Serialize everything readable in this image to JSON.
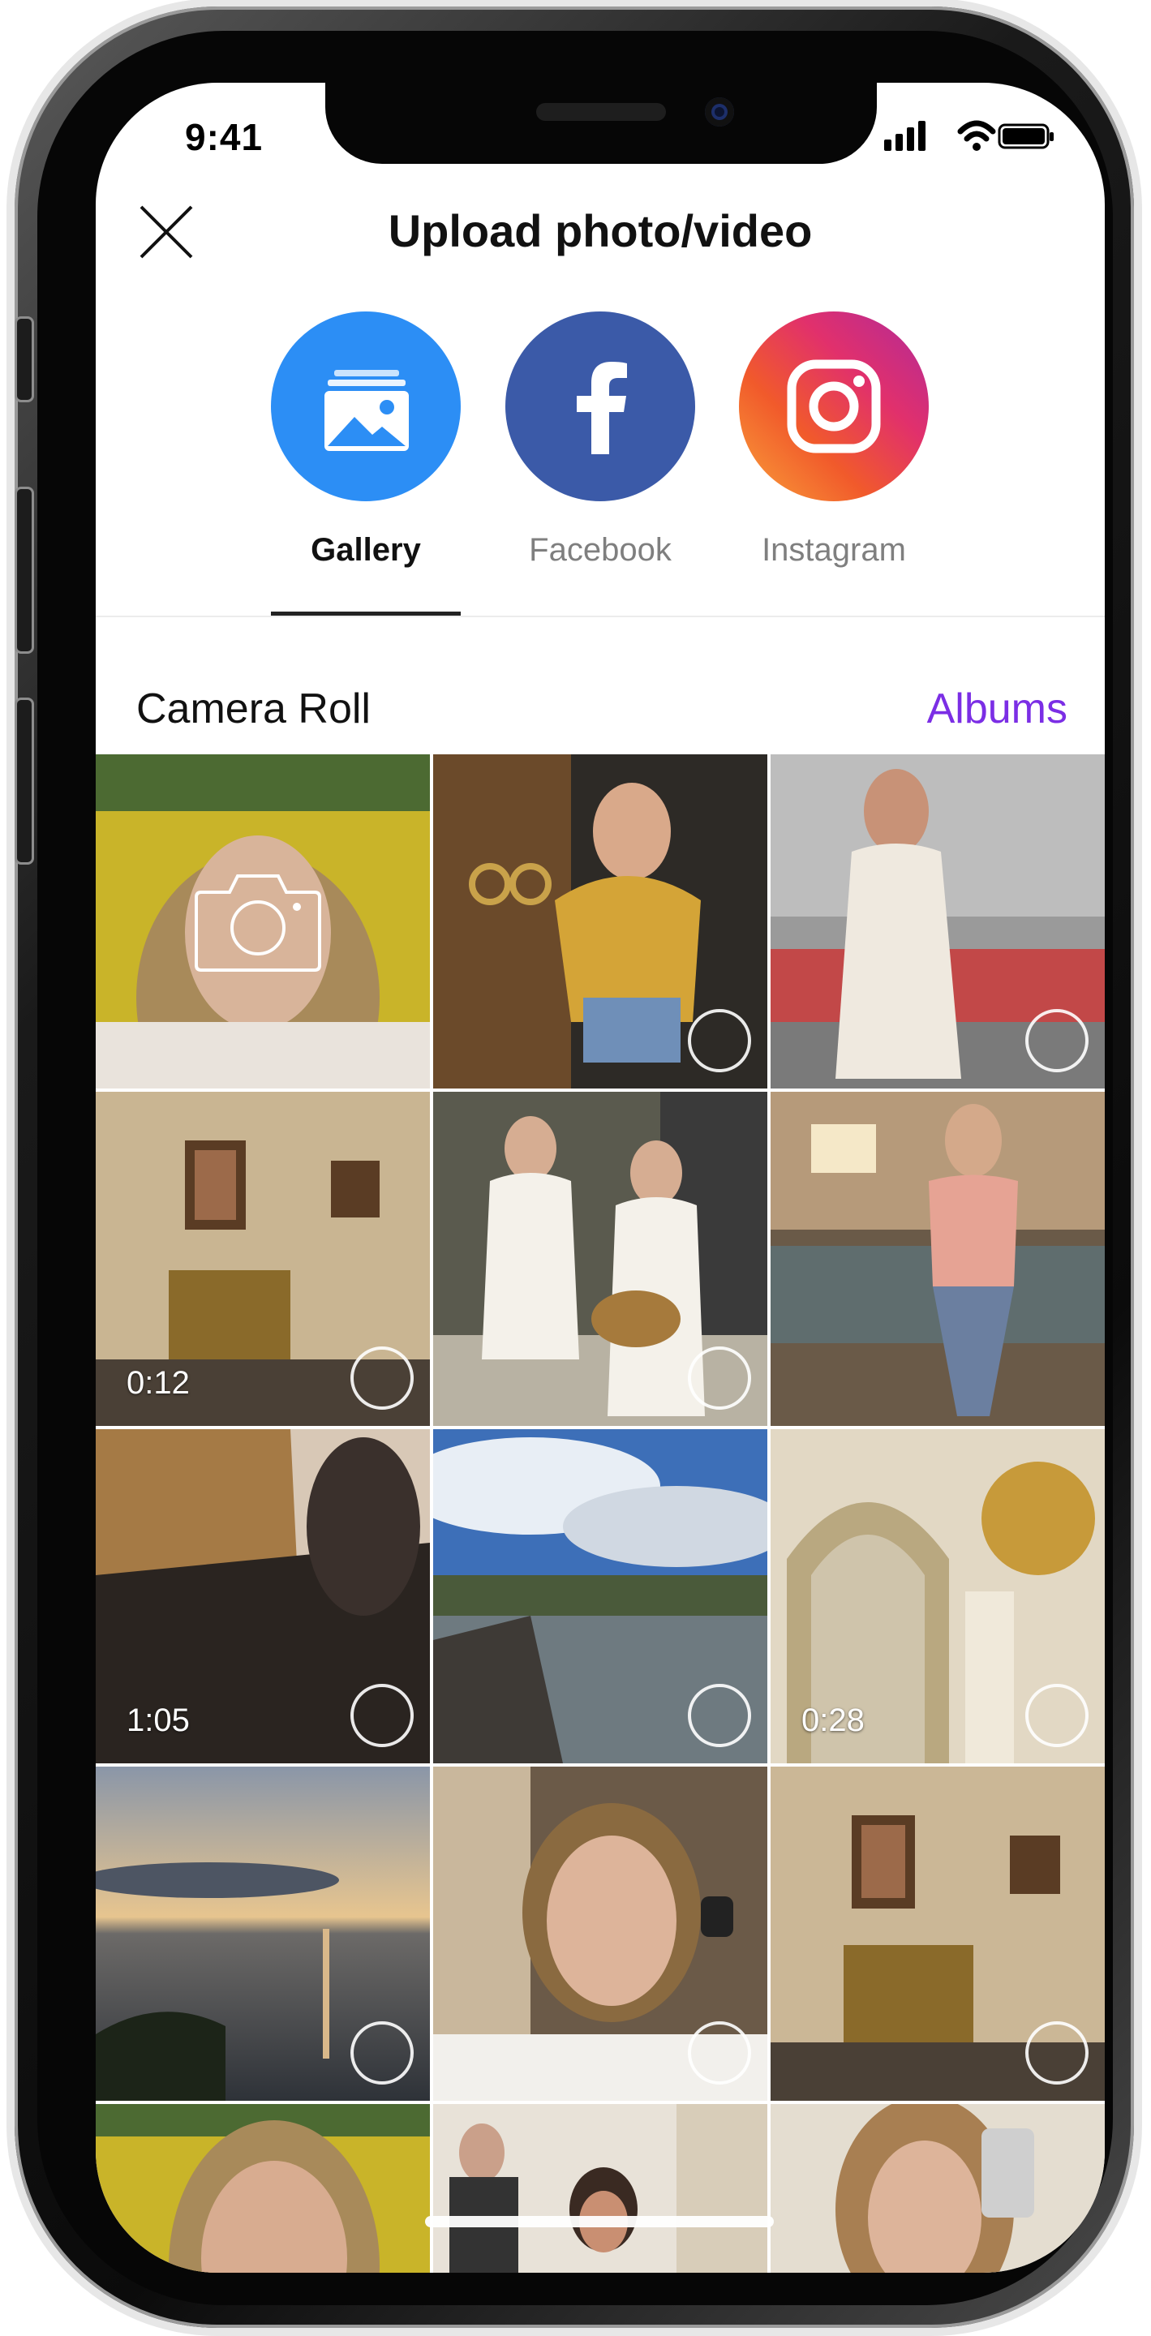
{
  "status_bar": {
    "time": "9:41"
  },
  "header": {
    "title": "Upload photo/video",
    "close_icon": "close-icon"
  },
  "sources": [
    {
      "id": "gallery",
      "label": "Gallery",
      "icon": "gallery-icon",
      "color": "#2c8ef5",
      "active": true
    },
    {
      "id": "facebook",
      "label": "Facebook",
      "icon": "facebook-icon",
      "color": "#3b5aa8",
      "active": false
    },
    {
      "id": "instagram",
      "label": "Instagram",
      "icon": "instagram-icon",
      "color": "#e1306c",
      "active": false
    }
  ],
  "camera_roll": {
    "title": "Camera Roll",
    "albums_label": "Albums",
    "albums_color": "#7b2ee5"
  },
  "grid": {
    "items": [
      {
        "kind": "camera",
        "icon": "camera-icon"
      },
      {
        "kind": "photo"
      },
      {
        "kind": "photo"
      },
      {
        "kind": "video",
        "duration": "0:12"
      },
      {
        "kind": "photo"
      },
      {
        "kind": "photo"
      },
      {
        "kind": "video",
        "duration": "1:05"
      },
      {
        "kind": "photo"
      },
      {
        "kind": "video",
        "duration": "0:28"
      },
      {
        "kind": "photo"
      },
      {
        "kind": "photo"
      },
      {
        "kind": "photo"
      },
      {
        "kind": "photo"
      },
      {
        "kind": "photo"
      },
      {
        "kind": "photo"
      }
    ]
  }
}
